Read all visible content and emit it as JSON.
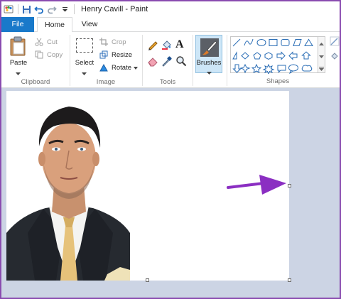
{
  "window": {
    "title": "Henry Cavill - Paint"
  },
  "tabs": {
    "file": "File",
    "home": "Home",
    "view": "View"
  },
  "ribbon": {
    "clipboard": {
      "paste": "Paste",
      "cut": "Cut",
      "copy": "Copy",
      "group_label": "Clipboard"
    },
    "image": {
      "select": "Select",
      "crop": "Crop",
      "resize": "Resize",
      "rotate": "Rotate",
      "group_label": "Image"
    },
    "tools": {
      "group_label": "Tools"
    },
    "brushes": {
      "label": "Brushes"
    },
    "shapes": {
      "group_label": "Shapes"
    }
  },
  "colors": {
    "file_tab": "#1979ca",
    "workspace": "#ccd4e4",
    "annotation_arrow": "#8b2fc2",
    "frame": "#8a4cb0"
  }
}
